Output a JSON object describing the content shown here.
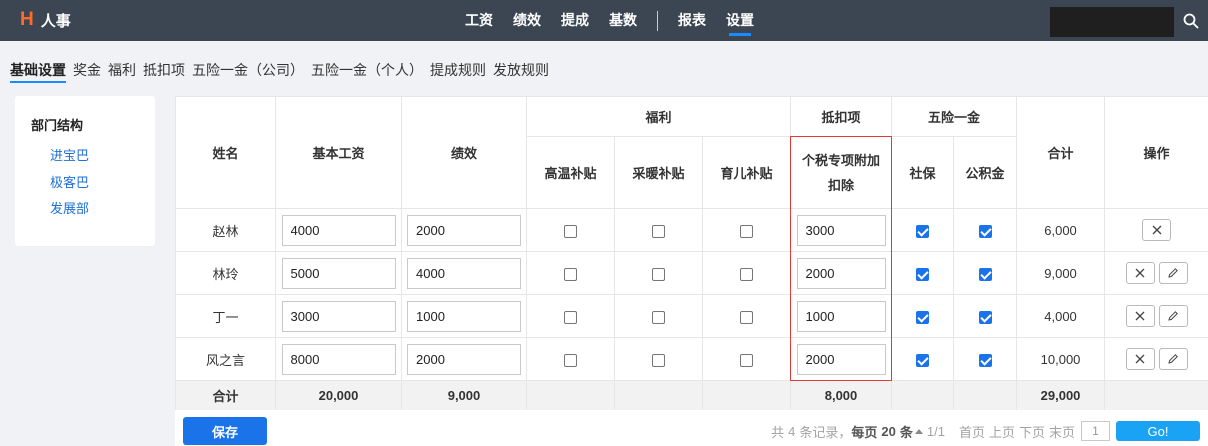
{
  "app": {
    "logo_letter": "H",
    "title": "人事"
  },
  "nav": [
    {
      "label": "工资"
    },
    {
      "label": "绩效"
    },
    {
      "label": "提成"
    },
    {
      "label": "基数"
    },
    {
      "label": "报表"
    },
    {
      "label": "设置"
    }
  ],
  "search": {
    "value": ""
  },
  "subtabs": [
    {
      "label": "基础设置"
    },
    {
      "label": "奖金"
    },
    {
      "label": "福利"
    },
    {
      "label": "抵扣项"
    },
    {
      "label": "五险一金（公司）"
    },
    {
      "label": "五险一金（个人）"
    },
    {
      "label": "提成规则"
    },
    {
      "label": "发放规则"
    }
  ],
  "sidebar": {
    "title": "部门结构",
    "items": [
      {
        "label": "进宝巴"
      },
      {
        "label": "极客巴"
      },
      {
        "label": "发展部"
      }
    ]
  },
  "table": {
    "headers": {
      "name": "姓名",
      "base": "基本工资",
      "perf": "绩效",
      "welfare": "福利",
      "deduct": "抵扣项",
      "insurance": "五险一金",
      "total": "合计",
      "ops": "操作",
      "heat": "高温补贴",
      "warm": "采暖补贴",
      "child": "育儿补贴",
      "tax": "个税专项附加扣除",
      "social": "社保",
      "fund": "公积金"
    },
    "rows": [
      {
        "name": "赵林",
        "base": "4000",
        "perf": "2000",
        "heat": false,
        "warm": false,
        "child": false,
        "tax": "3000",
        "social": true,
        "fund": true,
        "total": "6,000"
      },
      {
        "name": "林玲",
        "base": "5000",
        "perf": "4000",
        "heat": false,
        "warm": false,
        "child": false,
        "tax": "2000",
        "social": true,
        "fund": true,
        "total": "9,000"
      },
      {
        "name": "丁一",
        "base": "3000",
        "perf": "1000",
        "heat": false,
        "warm": false,
        "child": false,
        "tax": "1000",
        "social": true,
        "fund": true,
        "total": "4,000"
      },
      {
        "name": "风之言",
        "base": "8000",
        "perf": "2000",
        "heat": false,
        "warm": false,
        "child": false,
        "tax": "2000",
        "social": true,
        "fund": true,
        "total": "10,000"
      }
    ],
    "summary": {
      "label": "合计",
      "base": "20,000",
      "perf": "9,000",
      "tax": "8,000",
      "total": "29,000"
    }
  },
  "footer": {
    "save_label": "保存",
    "pager": {
      "records_prefix": "共",
      "records_count": "4",
      "records_suffix": "条记录，",
      "per_page_prefix": "每页",
      "per_page": "20",
      "per_page_suffix": "条",
      "page_info": "1/1",
      "first": "首页",
      "prev": "上页",
      "next": "下页",
      "last": "末页",
      "page_input": "1",
      "go": "Go!"
    }
  },
  "colors": {
    "topbar": "#3c4653",
    "accent": "#1a73e8",
    "logo": "#ff6a2b",
    "highlight_border": "#e03b3b"
  }
}
